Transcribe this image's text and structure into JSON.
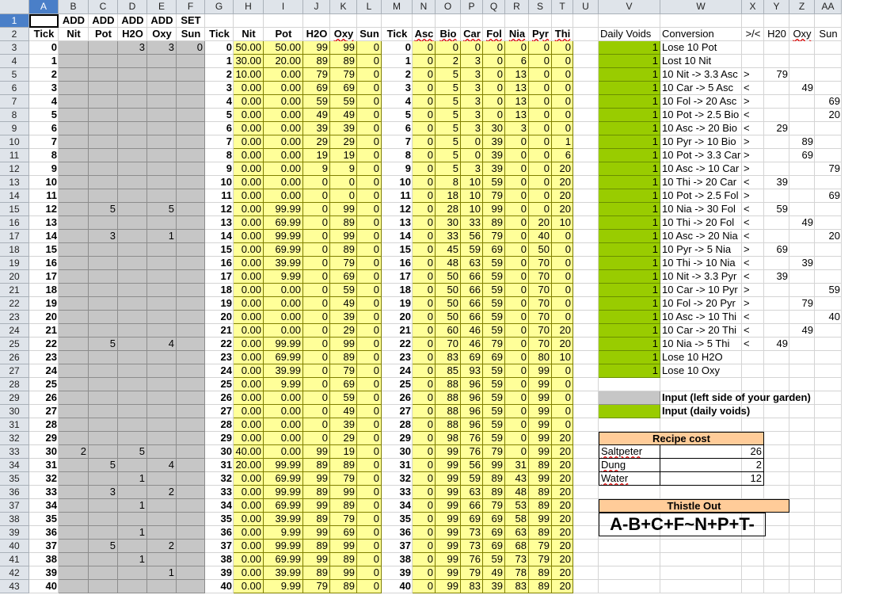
{
  "columns": [
    "A",
    "B",
    "C",
    "D",
    "E",
    "F",
    "G",
    "H",
    "I",
    "J",
    "K",
    "L",
    "M",
    "N",
    "O",
    "P",
    "Q",
    "R",
    "S",
    "T",
    "U",
    "V",
    "W",
    "X",
    "Y",
    "Z",
    "AA"
  ],
  "header_row1": {
    "B": "ADD",
    "C": "ADD",
    "D": "ADD",
    "E": "ADD",
    "F": "SET"
  },
  "header_row2": {
    "A": "Tick",
    "B": "Nit",
    "C": "Pot",
    "D": "H2O",
    "E": "Oxy",
    "F": "Sun",
    "G": "Tick",
    "H": "Nit",
    "I": "Pot",
    "J": "H2O",
    "K": "Oxy",
    "L": "Sun",
    "M": "Tick",
    "N": "Asc",
    "O": "Bio",
    "P": "Car",
    "Q": "Fol",
    "R": "Nia",
    "S": "Pyr",
    "T": "Thi",
    "V": "Daily Voids",
    "W": "Conversion",
    "X": ">/<",
    "Y": "H20",
    "Z": "Oxy",
    "AA": "Sun"
  },
  "inputs": [
    {
      "D": "3",
      "E": "3",
      "F": "0"
    },
    {},
    {},
    {},
    {},
    {},
    {},
    {},
    {},
    {},
    {},
    {},
    {
      "C": "5",
      "E": "5"
    },
    {},
    {
      "C": "3",
      "E": "1"
    },
    {},
    {},
    {},
    {},
    {},
    {},
    {},
    {
      "C": "5",
      "E": "4"
    },
    {},
    {},
    {},
    {},
    {},
    {},
    {},
    {
      "B": "2",
      "D": "5"
    },
    {
      "C": "5",
      "E": "4"
    },
    {
      "D": "1"
    },
    {
      "C": "3",
      "E": "2"
    },
    {
      "D": "1"
    },
    {},
    {
      "D": "1"
    },
    {
      "C": "5",
      "E": "2"
    },
    {
      "D": "1"
    },
    {
      "E": "1"
    },
    {}
  ],
  "soil": [
    [
      "50.00",
      "50.00",
      "99",
      "99",
      "0"
    ],
    [
      "30.00",
      "20.00",
      "89",
      "89",
      "0"
    ],
    [
      "10.00",
      "0.00",
      "79",
      "79",
      "0"
    ],
    [
      "0.00",
      "0.00",
      "69",
      "69",
      "0"
    ],
    [
      "0.00",
      "0.00",
      "59",
      "59",
      "0"
    ],
    [
      "0.00",
      "0.00",
      "49",
      "49",
      "0"
    ],
    [
      "0.00",
      "0.00",
      "39",
      "39",
      "0"
    ],
    [
      "0.00",
      "0.00",
      "29",
      "29",
      "0"
    ],
    [
      "0.00",
      "0.00",
      "19",
      "19",
      "0"
    ],
    [
      "0.00",
      "0.00",
      "9",
      "9",
      "0"
    ],
    [
      "0.00",
      "0.00",
      "0",
      "0",
      "0"
    ],
    [
      "0.00",
      "0.00",
      "0",
      "0",
      "0"
    ],
    [
      "0.00",
      "99.99",
      "0",
      "99",
      "0"
    ],
    [
      "0.00",
      "69.99",
      "0",
      "89",
      "0"
    ],
    [
      "0.00",
      "99.99",
      "0",
      "99",
      "0"
    ],
    [
      "0.00",
      "69.99",
      "0",
      "89",
      "0"
    ],
    [
      "0.00",
      "39.99",
      "0",
      "79",
      "0"
    ],
    [
      "0.00",
      "9.99",
      "0",
      "69",
      "0"
    ],
    [
      "0.00",
      "0.00",
      "0",
      "59",
      "0"
    ],
    [
      "0.00",
      "0.00",
      "0",
      "49",
      "0"
    ],
    [
      "0.00",
      "0.00",
      "0",
      "39",
      "0"
    ],
    [
      "0.00",
      "0.00",
      "0",
      "29",
      "0"
    ],
    [
      "0.00",
      "99.99",
      "0",
      "99",
      "0"
    ],
    [
      "0.00",
      "69.99",
      "0",
      "89",
      "0"
    ],
    [
      "0.00",
      "39.99",
      "0",
      "79",
      "0"
    ],
    [
      "0.00",
      "9.99",
      "0",
      "69",
      "0"
    ],
    [
      "0.00",
      "0.00",
      "0",
      "59",
      "0"
    ],
    [
      "0.00",
      "0.00",
      "0",
      "49",
      "0"
    ],
    [
      "0.00",
      "0.00",
      "0",
      "39",
      "0"
    ],
    [
      "0.00",
      "0.00",
      "0",
      "29",
      "0"
    ],
    [
      "40.00",
      "0.00",
      "99",
      "19",
      "0"
    ],
    [
      "20.00",
      "99.99",
      "89",
      "89",
      "0"
    ],
    [
      "0.00",
      "69.99",
      "99",
      "79",
      "0"
    ],
    [
      "0.00",
      "99.99",
      "89",
      "99",
      "0"
    ],
    [
      "0.00",
      "69.99",
      "99",
      "89",
      "0"
    ],
    [
      "0.00",
      "39.99",
      "89",
      "79",
      "0"
    ],
    [
      "0.00",
      "9.99",
      "99",
      "69",
      "0"
    ],
    [
      "0.00",
      "99.99",
      "89",
      "99",
      "0"
    ],
    [
      "0.00",
      "69.99",
      "99",
      "89",
      "0"
    ],
    [
      "0.00",
      "39.99",
      "89",
      "99",
      "0"
    ],
    [
      "0.00",
      "9.99",
      "79",
      "89",
      "0"
    ]
  ],
  "vitamins": [
    [
      "0",
      "0",
      "0",
      "0",
      "0",
      "0",
      "0"
    ],
    [
      "0",
      "2",
      "3",
      "0",
      "6",
      "0",
      "0"
    ],
    [
      "0",
      "5",
      "3",
      "0",
      "13",
      "0",
      "0"
    ],
    [
      "0",
      "5",
      "3",
      "0",
      "13",
      "0",
      "0"
    ],
    [
      "0",
      "5",
      "3",
      "0",
      "13",
      "0",
      "0"
    ],
    [
      "0",
      "5",
      "3",
      "0",
      "13",
      "0",
      "0"
    ],
    [
      "0",
      "5",
      "3",
      "30",
      "3",
      "0",
      "0"
    ],
    [
      "0",
      "5",
      "0",
      "39",
      "0",
      "0",
      "1"
    ],
    [
      "0",
      "5",
      "0",
      "39",
      "0",
      "0",
      "6"
    ],
    [
      "0",
      "5",
      "3",
      "39",
      "0",
      "0",
      "20"
    ],
    [
      "0",
      "8",
      "10",
      "59",
      "0",
      "0",
      "20"
    ],
    [
      "0",
      "18",
      "10",
      "79",
      "0",
      "0",
      "20"
    ],
    [
      "0",
      "28",
      "10",
      "99",
      "0",
      "0",
      "20"
    ],
    [
      "0",
      "30",
      "33",
      "89",
      "0",
      "20",
      "10"
    ],
    [
      "0",
      "33",
      "56",
      "79",
      "0",
      "40",
      "0"
    ],
    [
      "0",
      "45",
      "59",
      "69",
      "0",
      "50",
      "0"
    ],
    [
      "0",
      "48",
      "63",
      "59",
      "0",
      "70",
      "0"
    ],
    [
      "0",
      "50",
      "66",
      "59",
      "0",
      "70",
      "0"
    ],
    [
      "0",
      "50",
      "66",
      "59",
      "0",
      "70",
      "0"
    ],
    [
      "0",
      "50",
      "66",
      "59",
      "0",
      "70",
      "0"
    ],
    [
      "0",
      "50",
      "66",
      "59",
      "0",
      "70",
      "0"
    ],
    [
      "0",
      "60",
      "46",
      "59",
      "0",
      "70",
      "20"
    ],
    [
      "0",
      "70",
      "46",
      "79",
      "0",
      "70",
      "20"
    ],
    [
      "0",
      "83",
      "69",
      "69",
      "0",
      "80",
      "10"
    ],
    [
      "0",
      "85",
      "93",
      "59",
      "0",
      "99",
      "0"
    ],
    [
      "0",
      "88",
      "96",
      "59",
      "0",
      "99",
      "0"
    ],
    [
      "0",
      "88",
      "96",
      "59",
      "0",
      "99",
      "0"
    ],
    [
      "0",
      "88",
      "96",
      "59",
      "0",
      "99",
      "0"
    ],
    [
      "0",
      "88",
      "96",
      "59",
      "0",
      "99",
      "0"
    ],
    [
      "0",
      "98",
      "76",
      "59",
      "0",
      "99",
      "20"
    ],
    [
      "0",
      "99",
      "76",
      "79",
      "0",
      "99",
      "20"
    ],
    [
      "0",
      "99",
      "56",
      "99",
      "31",
      "89",
      "20"
    ],
    [
      "0",
      "99",
      "59",
      "89",
      "43",
      "99",
      "20"
    ],
    [
      "0",
      "99",
      "63",
      "89",
      "48",
      "89",
      "20"
    ],
    [
      "0",
      "99",
      "66",
      "79",
      "53",
      "89",
      "20"
    ],
    [
      "0",
      "99",
      "69",
      "69",
      "58",
      "99",
      "20"
    ],
    [
      "0",
      "99",
      "73",
      "69",
      "63",
      "89",
      "20"
    ],
    [
      "0",
      "99",
      "73",
      "69",
      "68",
      "79",
      "20"
    ],
    [
      "0",
      "99",
      "76",
      "59",
      "73",
      "79",
      "20"
    ],
    [
      "0",
      "99",
      "79",
      "49",
      "78",
      "89",
      "20"
    ],
    [
      "0",
      "99",
      "83",
      "39",
      "83",
      "89",
      "20"
    ]
  ],
  "conversions": [
    {
      "v": "1",
      "w": "Lose 10 Pot",
      "x": "",
      "y": "",
      "z": "",
      "aa": ""
    },
    {
      "v": "1",
      "w": "Lost 10 Nit",
      "x": "",
      "y": "",
      "z": "",
      "aa": ""
    },
    {
      "v": "1",
      "w": "10 Nit -> 3.3 Asc",
      "x": ">",
      "y": "79",
      "z": "",
      "aa": ""
    },
    {
      "v": "1",
      "w": "10 Car -> 5 Asc",
      "x": "<",
      "y": "",
      "z": "49",
      "aa": ""
    },
    {
      "v": "1",
      "w": "10 Fol -> 20 Asc",
      "x": ">",
      "y": "",
      "z": "",
      "aa": "69"
    },
    {
      "v": "1",
      "w": "10 Pot -> 2.5 Bio",
      "x": "<",
      "y": "",
      "z": "",
      "aa": "20"
    },
    {
      "v": "1",
      "w": "10 Asc -> 20 Bio",
      "x": "<",
      "y": "29",
      "z": "",
      "aa": ""
    },
    {
      "v": "1",
      "w": "10 Pyr -> 10 Bio",
      "x": ">",
      "y": "",
      "z": "89",
      "aa": ""
    },
    {
      "v": "1",
      "w": "10 Pot -> 3.3 Car",
      "x": ">",
      "y": "",
      "z": "69",
      "aa": ""
    },
    {
      "v": "1",
      "w": "10 Asc -> 10 Car",
      "x": ">",
      "y": "",
      "z": "",
      "aa": "79"
    },
    {
      "v": "1",
      "w": "10 Thi -> 20 Car",
      "x": "<",
      "y": "39",
      "z": "",
      "aa": ""
    },
    {
      "v": "1",
      "w": "10 Pot -> 2.5 Fol",
      "x": ">",
      "y": "",
      "z": "",
      "aa": "69"
    },
    {
      "v": "1",
      "w": "10 Nia -> 30 Fol",
      "x": "<",
      "y": "59",
      "z": "",
      "aa": ""
    },
    {
      "v": "1",
      "w": "10 Thi -> 20 Fol",
      "x": "<",
      "y": "",
      "z": "49",
      "aa": ""
    },
    {
      "v": "1",
      "w": "10 Asc -> 20 Nia",
      "x": "<",
      "y": "",
      "z": "",
      "aa": "20"
    },
    {
      "v": "1",
      "w": "10 Pyr -> 5 Nia",
      "x": ">",
      "y": "69",
      "z": "",
      "aa": ""
    },
    {
      "v": "1",
      "w": "10 Thi -> 10 Nia",
      "x": "<",
      "y": "",
      "z": "39",
      "aa": ""
    },
    {
      "v": "1",
      "w": "10 Nit -> 3.3 Pyr",
      "x": "<",
      "y": "39",
      "z": "",
      "aa": ""
    },
    {
      "v": "1",
      "w": "10 Car -> 10 Pyr",
      "x": ">",
      "y": "",
      "z": "",
      "aa": "59"
    },
    {
      "v": "1",
      "w": "10 Fol -> 20 Pyr",
      "x": ">",
      "y": "",
      "z": "79",
      "aa": ""
    },
    {
      "v": "1",
      "w": "10 Asc -> 10 Thi",
      "x": "<",
      "y": "",
      "z": "",
      "aa": "40"
    },
    {
      "v": "1",
      "w": "10 Car -> 20 Thi",
      "x": "<",
      "y": "",
      "z": "49",
      "aa": ""
    },
    {
      "v": "1",
      "w": "10 Nia -> 5 Thi",
      "x": "<",
      "y": "49",
      "z": "",
      "aa": ""
    },
    {
      "v": "1",
      "w": "Lose 10 H2O",
      "x": "",
      "y": "",
      "z": "",
      "aa": ""
    },
    {
      "v": "1",
      "w": "Lose 10 Oxy",
      "x": "",
      "y": "",
      "z": "",
      "aa": ""
    }
  ],
  "legend": {
    "gray_label": "Input (left side of your garden)",
    "green_label": "Input (daily voids)"
  },
  "recipe": {
    "title": "Recipe cost",
    "items": [
      {
        "name": "Saltpeter",
        "value": "26"
      },
      {
        "name": "Dung",
        "value": "2"
      },
      {
        "name": "Water",
        "value": "12"
      }
    ]
  },
  "thistle": {
    "title": "Thistle Out",
    "value": "A-B+C+F~N+P+T-"
  },
  "colors": {
    "input_gray": "#c6c6c6",
    "data_yellow": "#ffff99",
    "void_green": "#99cc00",
    "recipe_orange": "#ffcc99",
    "selected_header": "#4a7fc8"
  }
}
